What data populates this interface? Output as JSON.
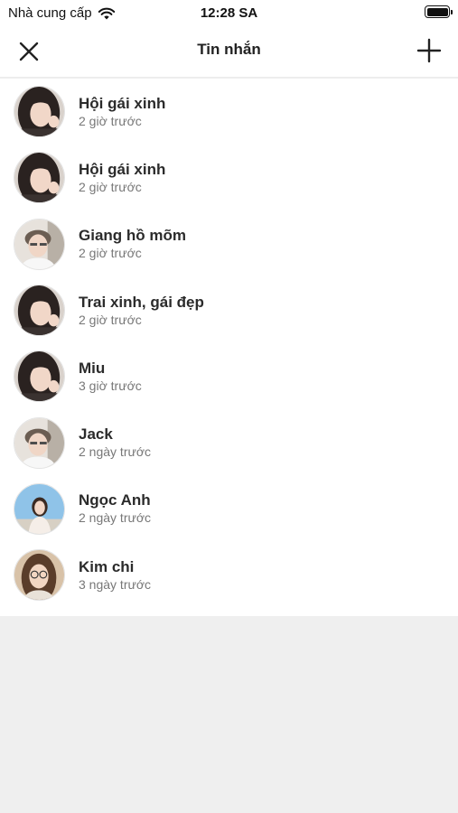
{
  "status_bar": {
    "carrier": "Nhà cung cấp",
    "time": "12:28 SA"
  },
  "header": {
    "title": "Tin nhắn",
    "left_icon": "close-icon",
    "right_icon": "plus-icon"
  },
  "conversations": [
    {
      "name": "Hội gái xinh",
      "time": "2 giờ trước",
      "avatar": "girl-dark-hair"
    },
    {
      "name": "Hội gái xinh",
      "time": "2 giờ trước",
      "avatar": "girl-dark-hair"
    },
    {
      "name": "Giang hồ mõm",
      "time": "2 giờ trước",
      "avatar": "boy-light"
    },
    {
      "name": "Trai xinh, gái đẹp",
      "time": "2 giờ trước",
      "avatar": "girl-dark-hair"
    },
    {
      "name": "Miu",
      "time": "3 giờ trước",
      "avatar": "girl-dark-hair"
    },
    {
      "name": "Jack",
      "time": "2 ngày trước",
      "avatar": "boy-light"
    },
    {
      "name": "Ngọc Anh",
      "time": "2 ngày trước",
      "avatar": "girl-sky"
    },
    {
      "name": "Kim chi",
      "time": "3 ngày trước",
      "avatar": "girl-glasses"
    }
  ],
  "colors": {
    "background": "#efefef",
    "surface": "#ffffff",
    "text_primary": "#2b2b2b",
    "text_secondary": "#777777"
  }
}
